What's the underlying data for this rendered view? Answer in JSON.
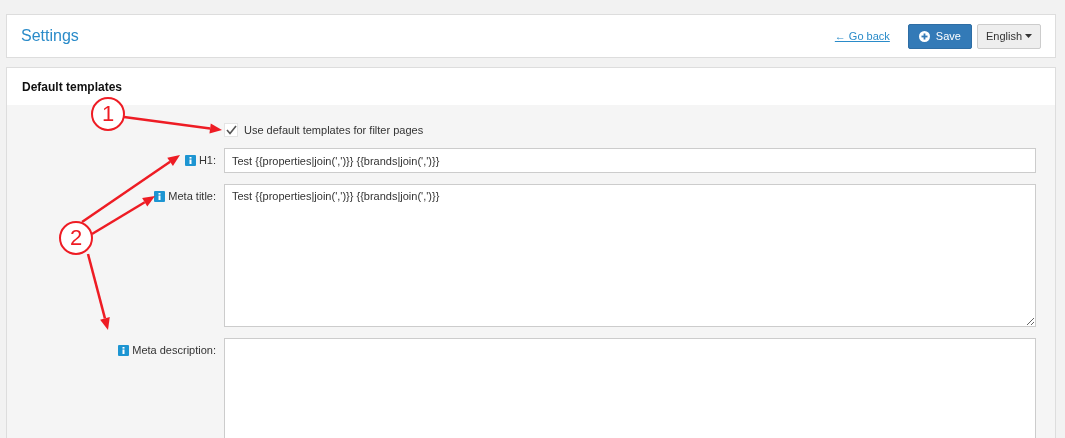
{
  "header": {
    "title": "Settings",
    "back_link": "← Go back",
    "save_button": "Save",
    "language": "English"
  },
  "panel": {
    "title": "Default templates",
    "checkbox": {
      "label": "Use default templates for filter pages",
      "checked": true
    },
    "fields": [
      {
        "kind": "input",
        "label": "H1:",
        "value": "Test {{properties|join(',')}} {{brands|join(',')}}"
      },
      {
        "kind": "textarea",
        "label": "Meta title:",
        "value": "Test {{properties|join(',')}} {{brands|join(',')}}"
      },
      {
        "kind": "textarea",
        "label": "Meta description:"
      }
    ]
  },
  "callouts": [
    {
      "number": "1"
    },
    {
      "number": "2"
    }
  ]
}
